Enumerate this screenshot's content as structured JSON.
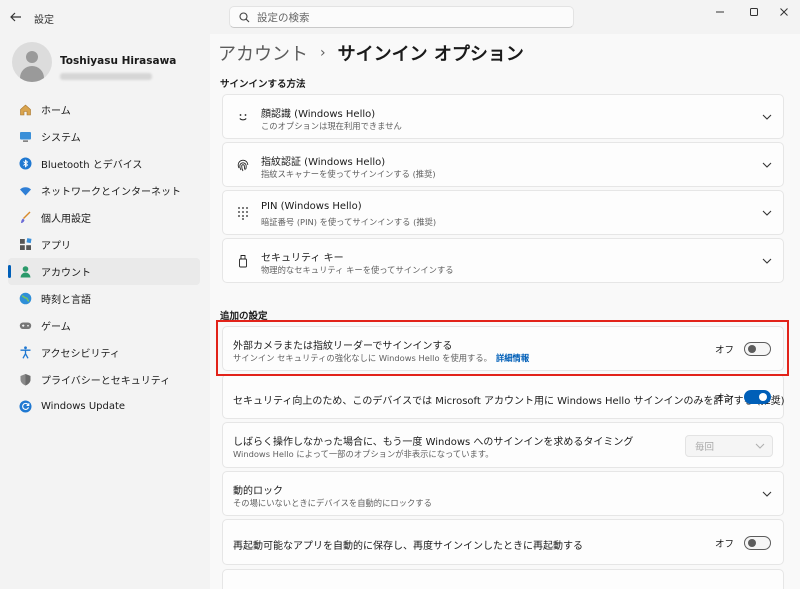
{
  "window": {
    "app_title": "設定",
    "search_placeholder": "設定の検索"
  },
  "profile": {
    "name": "Toshiyasu Hirasawa"
  },
  "nav": [
    {
      "label": "ホーム",
      "icon": "home-icon"
    },
    {
      "label": "システム",
      "icon": "monitor-icon"
    },
    {
      "label": "Bluetooth とデバイス",
      "icon": "bluetooth-icon"
    },
    {
      "label": "ネットワークとインターネット",
      "icon": "wifi-icon"
    },
    {
      "label": "個人用設定",
      "icon": "brush-icon"
    },
    {
      "label": "アプリ",
      "icon": "apps-icon"
    },
    {
      "label": "アカウント",
      "icon": "account-icon",
      "active": true
    },
    {
      "label": "時刻と言語",
      "icon": "globe-icon"
    },
    {
      "label": "ゲーム",
      "icon": "gamepad-icon"
    },
    {
      "label": "アクセシビリティ",
      "icon": "accessibility-icon"
    },
    {
      "label": "プライバシーとセキュリティ",
      "icon": "shield-icon"
    },
    {
      "label": "Windows Update",
      "icon": "update-icon"
    }
  ],
  "breadcrumb": {
    "parent": "アカウント",
    "separator": "›",
    "current": "サインイン オプション"
  },
  "signin_methods": {
    "title": "サインインする方法",
    "items": [
      {
        "title": "顔認識 (Windows Hello)",
        "subtitle": "このオプションは現在利用できません",
        "icon": "face-icon"
      },
      {
        "title": "指紋認証 (Windows Hello)",
        "subtitle": "指紋スキャナーを使ってサインインする (推奨)",
        "icon": "fingerprint-icon"
      },
      {
        "title": "PIN (Windows Hello)",
        "subtitle": "暗証番号 (PIN) を使ってサインインする (推奨)",
        "icon": "keypad-icon"
      },
      {
        "title": "セキュリティ キー",
        "subtitle": "物理的なセキュリティ キーを使ってサインインする",
        "icon": "security-key-icon"
      }
    ]
  },
  "additional": {
    "title": "追加の設定",
    "external_camera": {
      "title": "外部カメラまたは指紋リーダーでサインインする",
      "subtitle": "サインイン セキュリティの強化なしに Windows Hello を使用する。",
      "link": "詳細情報",
      "state": "オフ",
      "on": false
    },
    "hello_only": {
      "title": "セキュリティ向上のため、このデバイスでは Microsoft アカウント用に Windows Hello サインインのみを許可する (推奨)",
      "state": "オン",
      "on": true
    },
    "require_signin": {
      "title": "しばらく操作しなかった場合に、もう一度 Windows へのサインインを求めるタイミング",
      "subtitle": "Windows Hello によって一部のオプションが非表示になっています。",
      "dropdown": "毎回"
    },
    "dynamic_lock": {
      "title": "動的ロック",
      "subtitle": "その場にいないときにデバイスを自動的にロックする"
    },
    "restart_apps": {
      "title": "再起動可能なアプリを自動的に保存し、再度サインインしたときに再起動する",
      "state": "オフ",
      "on": false
    }
  }
}
